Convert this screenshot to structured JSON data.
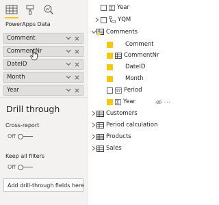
{
  "visualizations": {
    "buttons": [
      {
        "name": "fields-well-icon",
        "active": true
      },
      {
        "name": "format-paint-icon",
        "active": false
      },
      {
        "name": "analytics-icon",
        "active": false
      }
    ],
    "accent_color": "#f2c811",
    "visual_title": "PowerApps Data"
  },
  "wells": [
    {
      "label": "Comment"
    },
    {
      "label": "CommentNr"
    },
    {
      "label": "DateID"
    },
    {
      "label": "Month"
    },
    {
      "label": "Year"
    }
  ],
  "drill_through": {
    "title": "Drill through",
    "cross_report_label": "Cross-report",
    "cross_report_state": "Off",
    "keep_filters_label": "Keep all filters",
    "keep_filters_state": "Off",
    "add_fields_placeholder": "Add drill-through fields here"
  },
  "fields_pane": {
    "rows": [
      {
        "text": "Year",
        "type": "sum",
        "checked": false,
        "indent": 1
      },
      {
        "text": "YQM",
        "type": "hierarchy",
        "checked": false,
        "indent": 1,
        "expander": "collapsed"
      },
      {
        "text": "Comments",
        "type": "table",
        "checked": true,
        "indent": 0,
        "expander": "expanded"
      },
      {
        "text": "Comment",
        "type": "field",
        "checked": true,
        "indent": 2
      },
      {
        "text": "CommentNr",
        "type": "table-field",
        "checked": true,
        "indent": 2
      },
      {
        "text": "DateID",
        "type": "field",
        "checked": true,
        "indent": 2
      },
      {
        "text": "Month",
        "type": "field",
        "checked": true,
        "indent": 2
      },
      {
        "text": "Period",
        "type": "calendar",
        "checked": false,
        "indent": 2
      },
      {
        "text": "Year",
        "type": "sum",
        "checked": true,
        "indent": 2,
        "actions": [
          "hidden-eye-icon",
          "more-options-icon"
        ]
      },
      {
        "text": "Customers",
        "type": "table",
        "indent": 0,
        "expander": "collapsed"
      },
      {
        "text": "Period calculation",
        "type": "table",
        "indent": 0,
        "expander": "collapsed"
      },
      {
        "text": "Products",
        "type": "table",
        "indent": 0,
        "expander": "collapsed"
      },
      {
        "text": "Sales",
        "type": "table",
        "indent": 0,
        "expander": "collapsed"
      }
    ]
  }
}
